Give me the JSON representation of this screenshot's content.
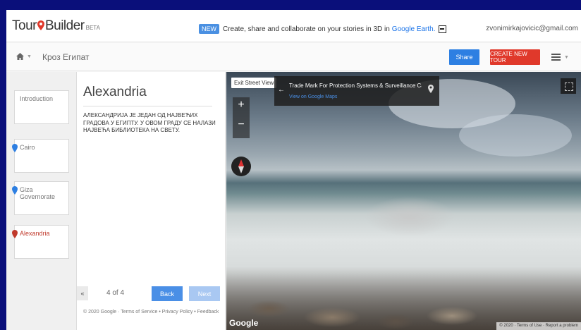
{
  "header": {
    "logo_tour": "Tour",
    "logo_builder": "Builder",
    "logo_beta": "BETA",
    "promo_badge": "NEW",
    "promo_text": "Create, share and collaborate on your stories in 3D in",
    "promo_link": "Google Earth.",
    "email": "zvonimirkajovicic@gmail.com"
  },
  "toolbar": {
    "tour_title": "Кроз Египат",
    "share_label": "Share",
    "create_label": "CREATE NEW TOUR"
  },
  "cards": [
    {
      "label": "Introduction",
      "pin": null
    },
    {
      "label": "Cairo",
      "pin": "blue"
    },
    {
      "label": "Giza Governorate",
      "pin": "blue"
    },
    {
      "label": "Alexandria",
      "pin": "red"
    }
  ],
  "detail": {
    "title": "Alexandria",
    "description": "АЛЕКСАНДРИЈА ЈЕ ЈЕДАН ОД НАЈВЕЋИХ ГРАДОВА У ЕГИПТУ. У ОВОМ ГРАДУ СЕ НАЛАЗИ НАЈВЕЋА БИБЛИОТЕКА НА СВЕТУ.",
    "collapse_label": "«",
    "page_count": "4 of 4",
    "back_label": "Back",
    "next_label": "Next",
    "footer": "© 2020 Google · Terms of Service • Privacy Policy • Feedback"
  },
  "streetview": {
    "exit_label": "Exit Street View",
    "info_title": "Trade Mark For Protection Systems & Surveillance Ca...",
    "info_link": "View on Google Maps",
    "google_logo": "Google",
    "terms": "© 2020 · Terms of Use · Report a problem"
  },
  "colors": {
    "background": "#0a0f7a",
    "share": "#2d7fe2",
    "create": "#e0392b",
    "pin_blue": "#2d7fe2",
    "pin_red": "#c0392b"
  },
  "icons": {
    "home": "home-icon",
    "menu": "menu-icon",
    "pin": "map-pin-icon",
    "fullscreen": "fullscreen-icon",
    "compass": "compass-icon"
  }
}
